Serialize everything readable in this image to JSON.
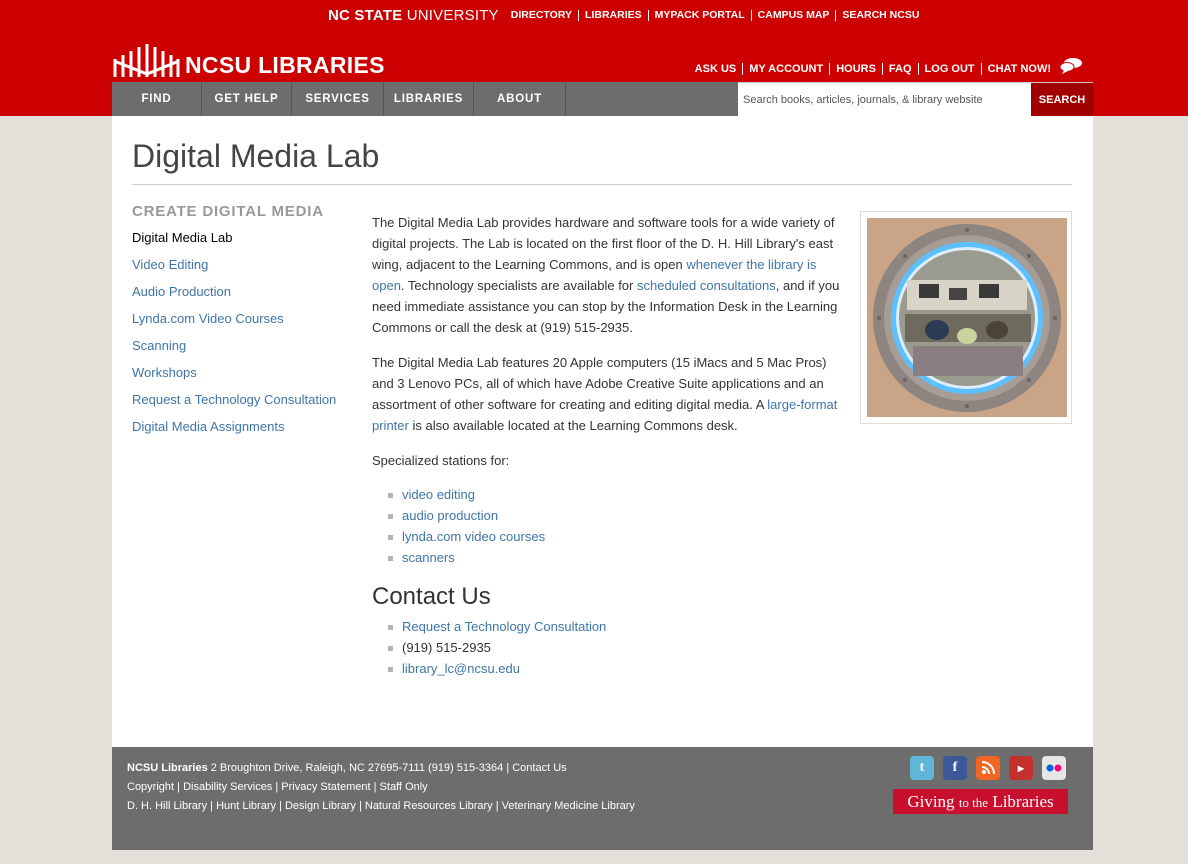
{
  "univ_bar": {
    "name_bold": "NC STATE",
    "name_rest": " UNIVERSITY",
    "links": [
      "DIRECTORY",
      "LIBRARIES",
      "MYPACK PORTAL",
      "CAMPUS MAP",
      "SEARCH NCSU"
    ]
  },
  "logo": {
    "bold": "NCSU ",
    "rest": "LIBRARIES"
  },
  "util_nav": [
    "ASK US",
    "MY ACCOUNT",
    "HOURS",
    "FAQ",
    "LOG OUT",
    "CHAT NOW!"
  ],
  "main_nav": [
    "FIND",
    "GET HELP",
    "SERVICES",
    "LIBRARIES",
    "ABOUT"
  ],
  "search": {
    "placeholder": "Search books, articles, journals, & library website",
    "button": "SEARCH"
  },
  "page_title": "Digital Media Lab",
  "sidebar": {
    "heading": "CREATE DIGITAL MEDIA",
    "items": [
      "Digital Media Lab",
      "Video Editing",
      "Audio Production",
      "Lynda.com Video Courses",
      "Scanning",
      "Workshops",
      "Request a Technology Consultation",
      "Digital Media Assignments"
    ]
  },
  "intro": {
    "p1_a": "The Digital Media Lab provides hardware and software tools for a wide variety of digital projects. The Lab is located on the first floor of the D. H. Hill Library's east wing, adjacent to the Learning Commons, and is open ",
    "p1_link1": "whenever the library is open",
    "p1_b": ". Technology specialists are available for ",
    "p1_link2": "scheduled consultations",
    "p1_c": ", and if you need immediate assistance you can stop by the Information Desk in the Learning Commons or call the desk at (919) 515-2935.",
    "p2_a": "The Digital Media Lab features 20 Apple computers (15 iMacs and 5 Mac Pros) and 3 Lenovo PCs, all of which have Adobe Creative Suite applications and an assortment of other software for creating and editing digital media.  A ",
    "p2_link": "large-format printer",
    "p2_b": " is also available located at the Learning Commons desk.",
    "stations_intro": "Specialized stations for:",
    "stations": [
      "video editing",
      "audio production",
      "lynda.com video courses",
      "scanners"
    ]
  },
  "contact": {
    "heading": "Contact Us",
    "link": "Request a Technology Consultation",
    "phone": "(919) 515-2935",
    "email": "library_lc@ncsu.edu"
  },
  "footer": {
    "org": "NCSU Libraries",
    "address": " 2 Broughton Drive, Raleigh, NC 27695-7111 (919) 515-3364 | ",
    "contact_link": "Contact Us",
    "line2": [
      "Copyright",
      "Disability Services",
      "Privacy Statement",
      "Staff Only"
    ],
    "line3": [
      "D. H. Hill Library",
      "Hunt Library",
      "Design Library",
      "Natural Resources Library",
      "Veterinary Medicine Library"
    ],
    "social": [
      "twitter-icon",
      "facebook-icon",
      "rss-icon",
      "youtube-icon",
      "flickr-icon"
    ],
    "giving_a": "Giving ",
    "giving_small": "to the",
    "giving_b": " Libraries"
  },
  "colors": {
    "header_red": "#cc0000",
    "nav_gray": "#6d6d6d",
    "link_blue": "#3f75a8",
    "search_btn": "#a10000"
  }
}
